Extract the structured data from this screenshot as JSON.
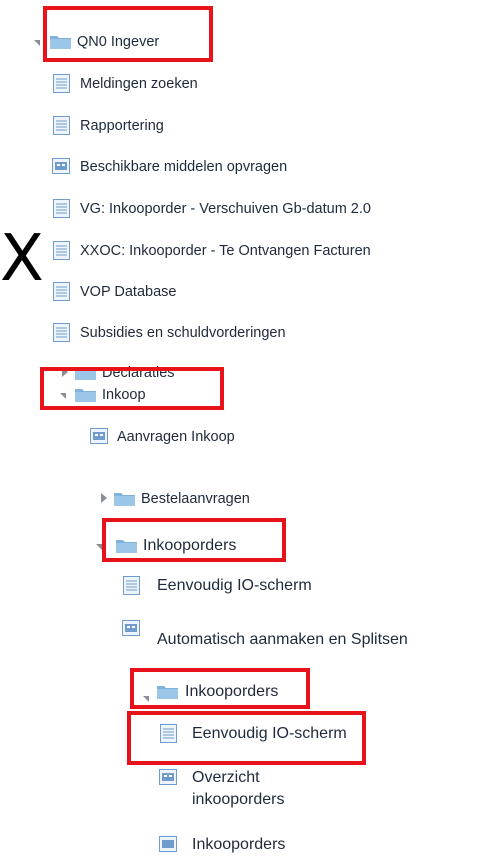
{
  "tree": {
    "root": {
      "label": "QN0 Ingever"
    },
    "items": {
      "meldingen": "Meldingen zoeken",
      "rapportering": "Rapportering",
      "beschikbare": "Beschikbare middelen opvragen",
      "vg_inkooporder": "VG: Inkooporder - Verschuiven Gb-datum 2.0",
      "xxoc": "XXOC: Inkooporder - Te Ontvangen Facturen",
      "vop": "VOP Database",
      "subsidies": "Subsidies en schuldvorderingen",
      "declaraties": "Declaraties",
      "inkoop": "Inkoop",
      "aanvragen": "Aanvragen Inkoop",
      "bestelaanvragen": "Bestelaanvragen",
      "inkooporders": "Inkooporders",
      "eenvoudig1": "Eenvoudig IO-scherm",
      "automatisch": "Automatisch aanmaken en Splitsen",
      "inkooporders2": "Inkooporders",
      "eenvoudig2": "Eenvoudig IO-scherm",
      "overzicht": "Overzicht inkooporders",
      "inkooporders3": "Inkooporders"
    }
  },
  "overlay": {
    "cropped_letter": "X"
  },
  "colors": {
    "highlight": "#e8121b",
    "folder": "#7fb2dc",
    "text": "#1e2a3a"
  }
}
